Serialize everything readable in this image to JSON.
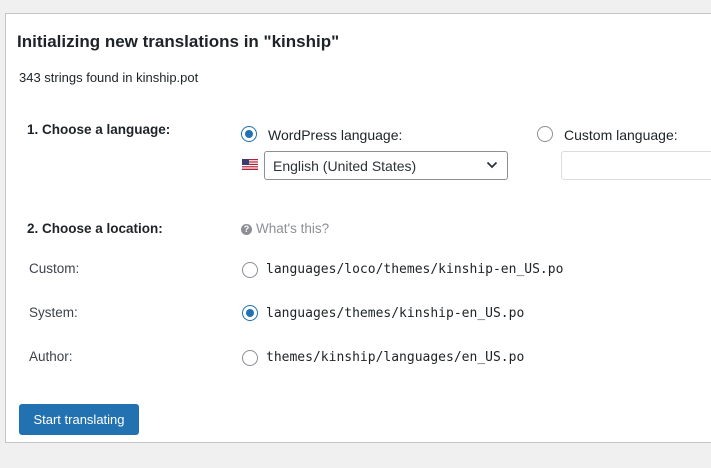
{
  "page": {
    "title": "Initializing new translations in \"kinship\"",
    "summary": "343 strings found in kinship.pot"
  },
  "language": {
    "heading": "1. Choose a language:",
    "wordpress_label": "WordPress language:",
    "custom_label": "Custom language:",
    "selected_language": "English (United States)",
    "selected_option": "wordpress"
  },
  "location": {
    "heading": "2. Choose a location:",
    "help_text": "What's this?",
    "options": [
      {
        "label": "Custom:",
        "path": "languages/loco/themes/kinship-en_US.po",
        "checked": false
      },
      {
        "label": "System:",
        "path": "languages/themes/kinship-en_US.po",
        "checked": true
      },
      {
        "label": "Author:",
        "path": "themes/kinship/languages/en_US.po",
        "checked": false
      }
    ]
  },
  "actions": {
    "start_label": "Start translating"
  },
  "colors": {
    "accent": "#2271b1",
    "background": "#f0f0f1"
  }
}
